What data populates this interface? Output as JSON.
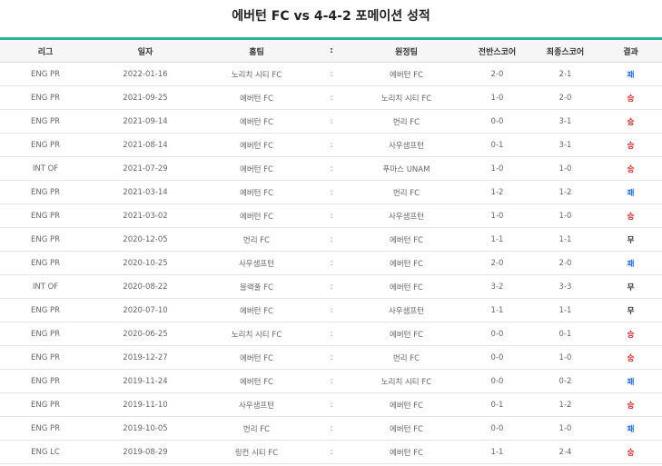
{
  "page": {
    "title": "에버턴 FC vs 4-4-2 포메이션 성적"
  },
  "table": {
    "headers": {
      "league": "리그",
      "date": "일자",
      "home": "홈팀",
      "sep": ":",
      "away": "원정팀",
      "half_score": "전반스코어",
      "final_score": "최종스코어",
      "result": "결과"
    },
    "rows": [
      {
        "league": "ENG PR",
        "date": "2022-01-16",
        "home": "노리치 시티 FC",
        "sep": ":",
        "away": "에버턴 FC",
        "half": "2-0",
        "final": "2-1",
        "result": "패",
        "kind": "loss"
      },
      {
        "league": "ENG PR",
        "date": "2021-09-25",
        "home": "에버턴 FC",
        "sep": ":",
        "away": "노리치 시티 FC",
        "half": "1-0",
        "final": "2-0",
        "result": "승",
        "kind": "win"
      },
      {
        "league": "ENG PR",
        "date": "2021-09-14",
        "home": "에버턴 FC",
        "sep": ":",
        "away": "번리 FC",
        "half": "0-0",
        "final": "3-1",
        "result": "승",
        "kind": "win"
      },
      {
        "league": "ENG PR",
        "date": "2021-08-14",
        "home": "에버턴 FC",
        "sep": ":",
        "away": "사우샘프턴",
        "half": "0-1",
        "final": "3-1",
        "result": "승",
        "kind": "win"
      },
      {
        "league": "INT OF",
        "date": "2021-07-29",
        "home": "에버턴 FC",
        "sep": ":",
        "away": "푸마스 UNAM",
        "half": "1-0",
        "final": "1-0",
        "result": "승",
        "kind": "win"
      },
      {
        "league": "ENG PR",
        "date": "2021-03-14",
        "home": "에버턴 FC",
        "sep": ":",
        "away": "번리 FC",
        "half": "1-2",
        "final": "1-2",
        "result": "패",
        "kind": "loss"
      },
      {
        "league": "ENG PR",
        "date": "2021-03-02",
        "home": "에버턴 FC",
        "sep": ":",
        "away": "사우샘프턴",
        "half": "1-0",
        "final": "1-0",
        "result": "승",
        "kind": "win"
      },
      {
        "league": "ENG PR",
        "date": "2020-12-05",
        "home": "번리 FC",
        "sep": ":",
        "away": "에버턴 FC",
        "half": "1-1",
        "final": "1-1",
        "result": "무",
        "kind": "draw"
      },
      {
        "league": "ENG PR",
        "date": "2020-10-25",
        "home": "사우샘프턴",
        "sep": ":",
        "away": "에버턴 FC",
        "half": "2-0",
        "final": "2-0",
        "result": "패",
        "kind": "loss"
      },
      {
        "league": "INT OF",
        "date": "2020-08-22",
        "home": "블랙풀 FC",
        "sep": ":",
        "away": "에버턴 FC",
        "half": "3-2",
        "final": "3-3",
        "result": "무",
        "kind": "draw"
      },
      {
        "league": "ENG PR",
        "date": "2020-07-10",
        "home": "에버턴 FC",
        "sep": ":",
        "away": "사우샘프턴",
        "half": "1-1",
        "final": "1-1",
        "result": "무",
        "kind": "draw"
      },
      {
        "league": "ENG PR",
        "date": "2020-06-25",
        "home": "노리치 시티 FC",
        "sep": ":",
        "away": "에버턴 FC",
        "half": "0-0",
        "final": "0-1",
        "result": "승",
        "kind": "win"
      },
      {
        "league": "ENG PR",
        "date": "2019-12-27",
        "home": "에버턴 FC",
        "sep": ":",
        "away": "번리 FC",
        "half": "0-0",
        "final": "1-0",
        "result": "승",
        "kind": "win"
      },
      {
        "league": "ENG PR",
        "date": "2019-11-24",
        "home": "에버턴 FC",
        "sep": ":",
        "away": "노리치 시티 FC",
        "half": "0-0",
        "final": "0-2",
        "result": "패",
        "kind": "loss"
      },
      {
        "league": "ENG PR",
        "date": "2019-11-10",
        "home": "사우샘프턴",
        "sep": ":",
        "away": "에버턴 FC",
        "half": "0-1",
        "final": "1-2",
        "result": "승",
        "kind": "win"
      },
      {
        "league": "ENG PR",
        "date": "2019-10-05",
        "home": "번리 FC",
        "sep": ":",
        "away": "에버턴 FC",
        "half": "0-0",
        "final": "1-0",
        "result": "패",
        "kind": "loss"
      },
      {
        "league": "ENG LC",
        "date": "2019-08-29",
        "home": "링컨 시티 FC",
        "sep": ":",
        "away": "에버턴 FC",
        "half": "1-1",
        "final": "2-4",
        "result": "승",
        "kind": "win"
      }
    ]
  },
  "colors": {
    "accent": "#2bb598",
    "win": "#e02020",
    "loss": "#1d6cf0",
    "draw": "#333333"
  }
}
